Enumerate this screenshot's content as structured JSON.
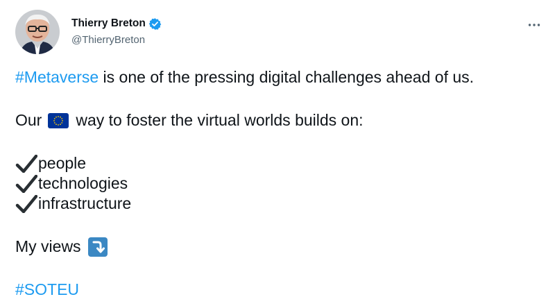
{
  "author": {
    "display_name": "Thierry Breton",
    "handle": "@ThierryBreton",
    "verified": true,
    "avatar_icon": "profile-photo"
  },
  "tweet": {
    "line1_hashtag": "#Metaverse",
    "line1_rest": " is one of the pressing digital challenges ahead of us.",
    "line2_before": "Our",
    "line2_flag_icon": "eu-flag-icon",
    "line2_after": "way to foster the virtual worlds builds on:",
    "checklist": [
      "people",
      "technologies",
      "infrastructure"
    ],
    "views_text": "My views",
    "views_icon": "arrow-down-right-icon",
    "closing_hashtag": "#SOTEU"
  },
  "colors": {
    "link": "#1d9bf0",
    "text": "#0f1419",
    "secondary": "#536471",
    "verified_badge": "#1d9bf0",
    "eu_blue": "#003399",
    "eu_star": "#ffcc00",
    "arrow_bg": "#3b88c3"
  },
  "menu_icon": "more-horizontal-icon"
}
